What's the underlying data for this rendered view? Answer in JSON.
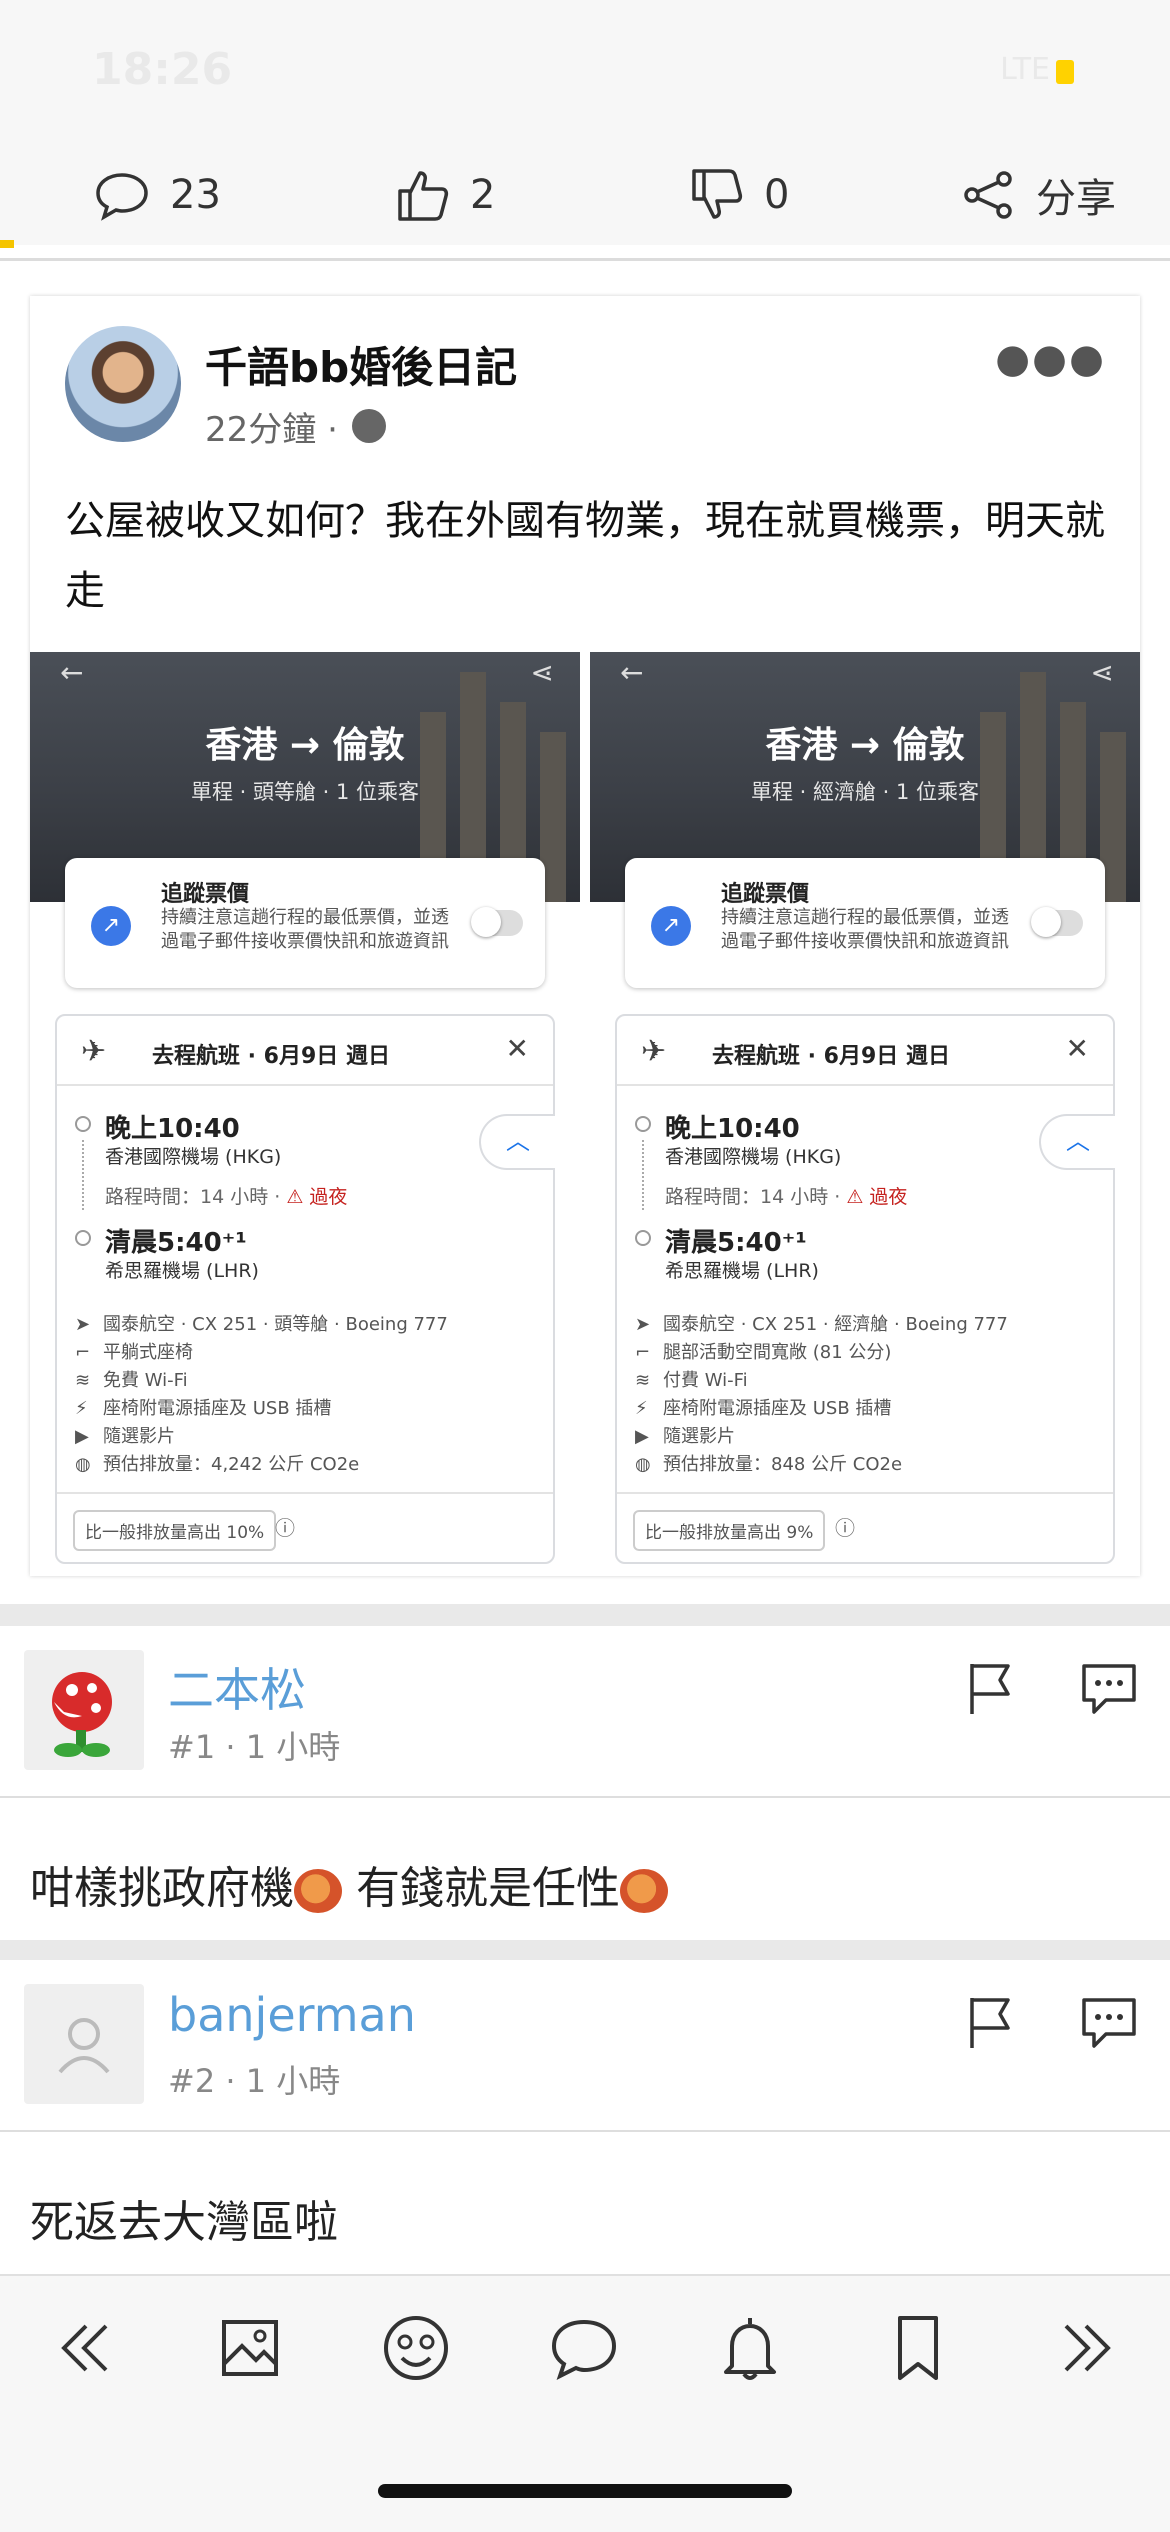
{
  "status": {
    "time": "18:26",
    "network": "LTE"
  },
  "actions": {
    "comments": "23",
    "likes": "2",
    "dislikes": "0",
    "share_label": "分享"
  },
  "fb_post": {
    "author": "千語bb婚後日記",
    "time": "22分鐘 ·",
    "text": "公屋被收又如何？我在外國有物業，現在就買機票，明天就走",
    "screenshots": [
      {
        "route": "香港 → 倫敦",
        "subtitle": "單程 · 頭等艙 · 1 位乘客",
        "track_title": "追蹤票價",
        "track_desc": "持續注意這趟行程的最低票價，並透過電子郵件接收票價快訊和旅遊資訊",
        "flight_title": "去程航班 · 6月9日 週日",
        "dep_time": "晚上10:40",
        "dep_airport": "香港國際機場 (HKG)",
        "duration": "路程時間：14 小時 ·",
        "overnight": "過夜",
        "arr_time": "清晨5:40⁺¹",
        "arr_airport": "希思羅機場 (LHR)",
        "amenities": [
          "國泰航空 · CX 251 · 頭等艙 · Boeing 777",
          "平躺式座椅",
          "免費 Wi-Fi",
          "座椅附電源插座及 USB 插槽",
          "隨選影片",
          "預估排放量：4,242 公斤 CO2e"
        ],
        "emission_note": "比一般排放量高出 10%"
      },
      {
        "route": "香港 → 倫敦",
        "subtitle": "單程 · 經濟艙 · 1 位乘客",
        "track_title": "追蹤票價",
        "track_desc": "持續注意這趟行程的最低票價，並透過電子郵件接收票價快訊和旅遊資訊",
        "flight_title": "去程航班 · 6月9日 週日",
        "dep_time": "晚上10:40",
        "dep_airport": "香港國際機場 (HKG)",
        "duration": "路程時間：14 小時 ·",
        "overnight": "過夜",
        "arr_time": "清晨5:40⁺¹",
        "arr_airport": "希思羅機場 (LHR)",
        "amenities": [
          "國泰航空 · CX 251 · 經濟艙 · Boeing 777",
          "腿部活動空間寬敞 (81 公分)",
          "付費 Wi-Fi",
          "座椅附電源插座及 USB 插槽",
          "隨選影片",
          "預估排放量：848 公斤 CO2e"
        ],
        "emission_note": "比一般排放量高出 9%"
      }
    ]
  },
  "replies": [
    {
      "name": "二本松",
      "meta": "#1  · 1 小時",
      "body": "咁樣挑政府機",
      "body2": "有錢就是任性"
    },
    {
      "name": "banjerman",
      "meta": "#2  · 1 小時",
      "body": "死返去大灣區啦"
    }
  ],
  "toolbar": {
    "icons": [
      "first-page-icon",
      "image-icon",
      "emoji-icon",
      "comment-icon",
      "bell-icon",
      "bookmark-icon",
      "last-page-icon"
    ]
  }
}
